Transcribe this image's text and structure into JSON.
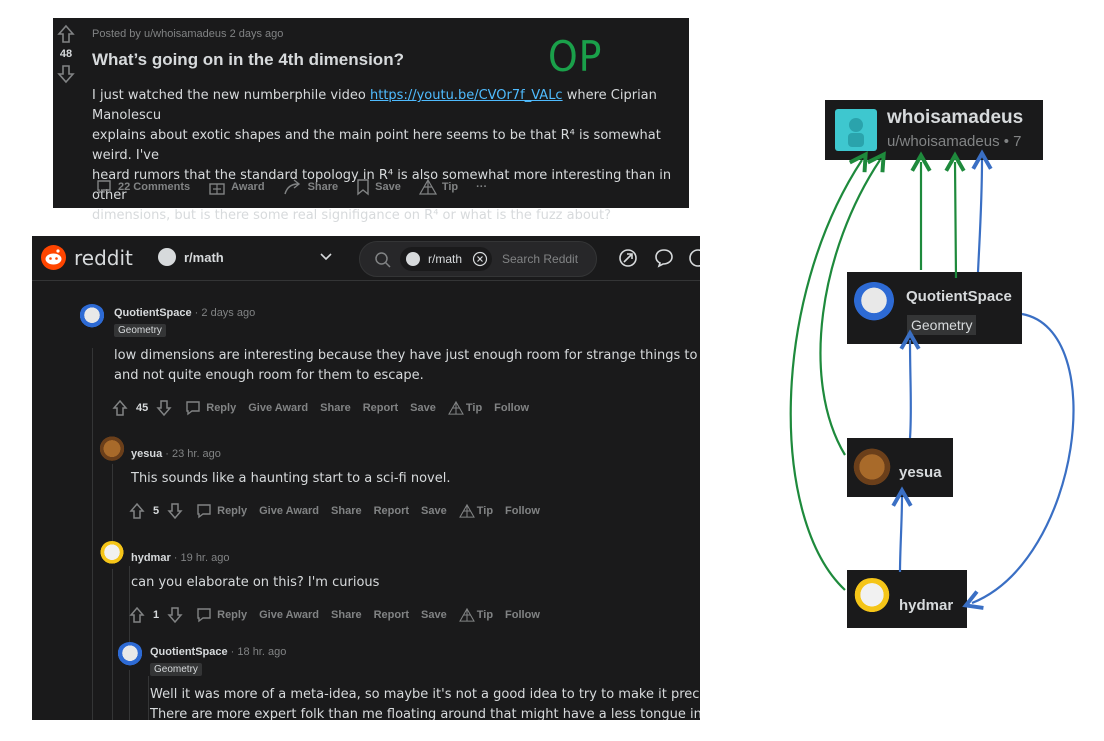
{
  "post": {
    "vote_count": "48",
    "meta": "Posted by u/whoisamadeus 2 days ago",
    "title": "What’s going on in the 4th dimension?",
    "op_annotation": "OP",
    "body_line1_pre": "I just watched the new numberphile video ",
    "link": "https://youtu.be/CVOr7f_VALc",
    "body_line1_post": " where Ciprian Manolescu",
    "body_line2": "explains about exotic shapes and the main point here seems to be that R⁴ is somewhat weird. I've",
    "body_line3": "heard rumors that the standard topology in R⁴ is also somewhat more interesting than in other",
    "body_line4": "dimensions, but is there some real signifigance on R⁴ or what is the fuzz about?",
    "actions": {
      "comments": "22 Comments",
      "award": "Award",
      "share": "Share",
      "save": "Save",
      "tip": "Tip",
      "more": "···"
    }
  },
  "topbar": {
    "logo": "reddit",
    "subreddit": "r/math",
    "search_chip": "r/math",
    "search_placeholder": "Search Reddit"
  },
  "comments": [
    {
      "user": "QuotientSpace",
      "time": " · 2 days ago",
      "flair": "Geometry",
      "body": [
        "low dimensions are interesting because they have just enough room for strange things to live",
        "and not quite enough room for them to escape."
      ],
      "score": "45",
      "actions": [
        "Reply",
        "Give Award",
        "Share",
        "Report",
        "Save",
        "Tip",
        "Follow"
      ]
    },
    {
      "user": "yesua",
      "time": " · 23 hr. ago",
      "body": [
        "This sounds like a haunting start to a sci-fi novel."
      ],
      "score": "5",
      "actions": [
        "Reply",
        "Give Award",
        "Share",
        "Report",
        "Save",
        "Tip",
        "Follow"
      ]
    },
    {
      "user": "hydmar",
      "time": " · 19 hr. ago",
      "body": [
        "can you elaborate on this? I'm curious"
      ],
      "score": "1",
      "actions": [
        "Reply",
        "Give Award",
        "Share",
        "Report",
        "Save",
        "Tip",
        "Follow"
      ]
    },
    {
      "user": "QuotientSpace",
      "time": " · 18 hr. ago",
      "flair": "Geometry",
      "body": [
        "Well it was more of a meta-idea, so maybe it's not a good idea to try to make it precise.",
        "There are more expert folk than me floating around that might have a less tongue in cheek"
      ]
    }
  ],
  "diagram": {
    "op": {
      "name": "whoisamadeus",
      "handle": "u/whoisamadeus • 7"
    },
    "quotient": {
      "name": "QuotientSpace",
      "flair": "Geometry"
    },
    "yesua": {
      "name": "yesua"
    },
    "hydmar": {
      "name": "hydmar"
    },
    "colors": {
      "green": "#1e8a3c",
      "blue": "#3a6fc4"
    }
  }
}
